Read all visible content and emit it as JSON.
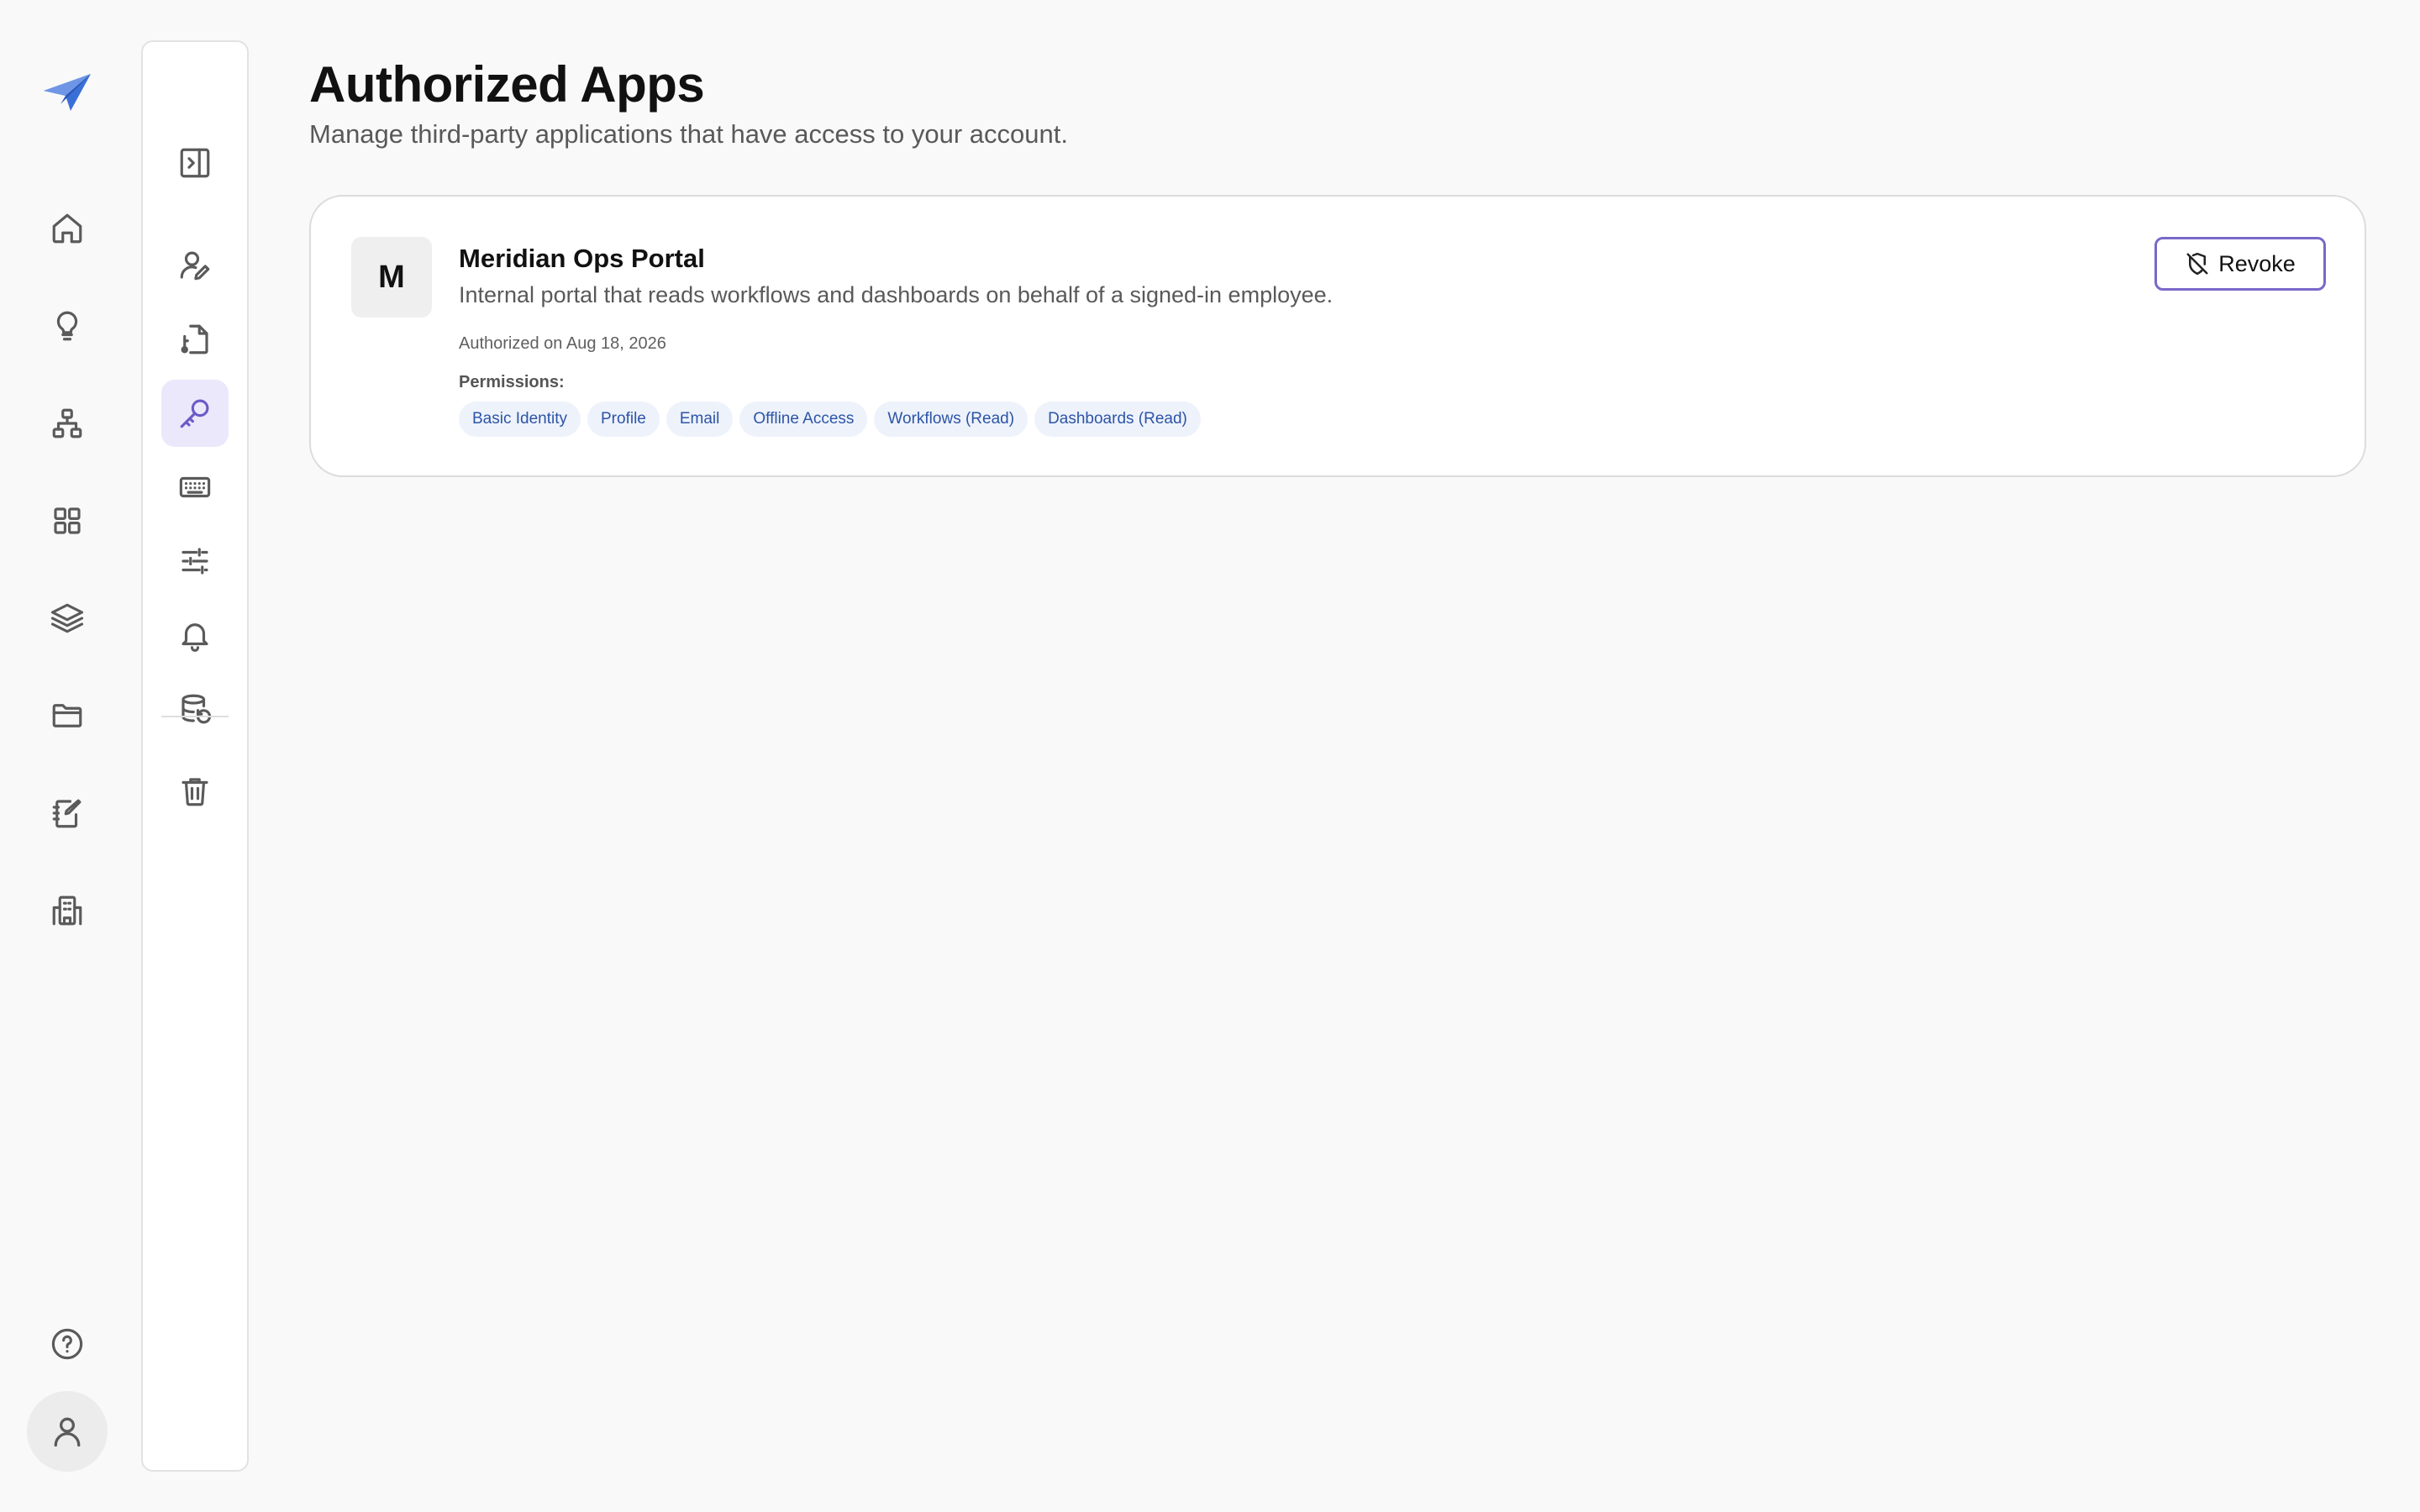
{
  "rail": {
    "items": [
      {
        "icon": "home-icon"
      },
      {
        "icon": "lightbulb-icon"
      },
      {
        "icon": "org-chart-icon"
      },
      {
        "icon": "grid-icon"
      },
      {
        "icon": "layers-icon"
      },
      {
        "icon": "folder-icon"
      },
      {
        "icon": "notebook-edit-icon"
      },
      {
        "icon": "building-icon"
      }
    ],
    "bottom": [
      {
        "icon": "help-circle-icon"
      },
      {
        "icon": "user-icon"
      }
    ]
  },
  "settings_panel": {
    "items": [
      {
        "icon": "collapse-panel-icon",
        "active": false
      },
      {
        "icon": "user-edit-icon",
        "active": false
      },
      {
        "icon": "file-key-icon",
        "active": false
      },
      {
        "icon": "key-icon",
        "active": true
      },
      {
        "icon": "keyboard-icon",
        "active": false
      },
      {
        "icon": "sliders-icon",
        "active": false
      },
      {
        "icon": "bell-icon",
        "active": false
      },
      {
        "icon": "database-restore-icon",
        "active": false
      },
      {
        "icon": "trash-icon",
        "active": false
      }
    ]
  },
  "main": {
    "title": "Authorized Apps",
    "subtitle": "Manage third-party applications that have access to your account.",
    "apps": [
      {
        "initial": "M",
        "name": "Meridian Ops Portal",
        "description": "Internal portal that reads workflows and dashboards on behalf of a signed-in employee.",
        "authorized_on": "Authorized on Aug 18, 2026",
        "permissions_label": "Permissions:",
        "permissions": [
          "Basic Identity",
          "Profile",
          "Email",
          "Offline Access",
          "Workflows (Read)",
          "Dashboards (Read)"
        ],
        "revoke_label": "Revoke"
      }
    ]
  },
  "colors": {
    "accent": "#7a68c9",
    "active_bg": "#ebe8fb",
    "chip_bg": "#eef2fb",
    "chip_text": "#2c55a6",
    "brand": "#3b6fd8"
  }
}
